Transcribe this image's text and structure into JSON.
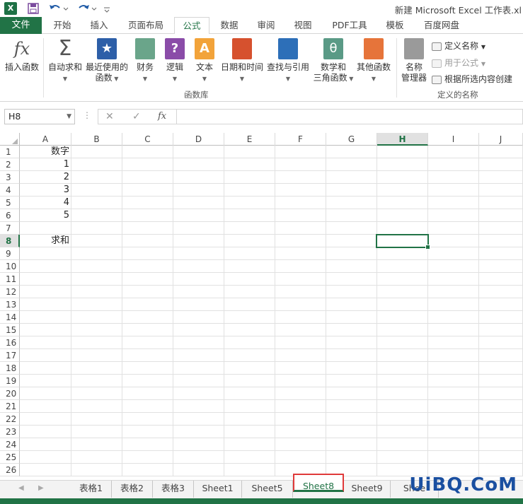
{
  "titlebar": {
    "logo": "X",
    "title": "新建 Microsoft Excel 工作表.xl"
  },
  "menu": {
    "file": "文件",
    "tabs": [
      "开始",
      "插入",
      "页面布局",
      "公式",
      "数据",
      "审阅",
      "视图",
      "PDF工具",
      "模板",
      "百度网盘"
    ],
    "active_index": 3
  },
  "ribbon": {
    "insert_function": "插入函数",
    "autosum": "自动求和",
    "recent_1": "最近使用的",
    "recent_2": "函数",
    "finance": "财务",
    "logic": "逻辑",
    "text": "文本",
    "datetime": "日期和时间",
    "lookup": "查找与引用",
    "math_1": "数学和",
    "math_2": "三角函数",
    "other": "其他函数",
    "group_functions": "函数库",
    "name_manager_1": "名称",
    "name_manager_2": "管理器",
    "define_name": "定义名称",
    "use_in_formula": "用于公式",
    "create_from_selection": "根据所选内容创建",
    "group_names": "定义的名称"
  },
  "formula_bar": {
    "name_box": "H8",
    "cancel": "✕",
    "enter": "✓",
    "fx": "fx",
    "content": ""
  },
  "sheet": {
    "columns": [
      "A",
      "B",
      "C",
      "D",
      "E",
      "F",
      "G",
      "H",
      "I",
      "J"
    ],
    "selected_column": "H",
    "selected_row": 8,
    "row_count": 26,
    "cells": {
      "A1": "数字",
      "A2": "1",
      "A3": "2",
      "A4": "3",
      "A5": "4",
      "A6": "5",
      "A8": "求和"
    }
  },
  "tabs": {
    "sheets": [
      "表格1",
      "表格2",
      "表格3",
      "Sheet1",
      "Sheet5",
      "Sheet8",
      "Sheet9",
      "Shee"
    ],
    "active": "Sheet8"
  },
  "watermark": "UiBQ.CoM",
  "colors": {
    "excel_green": "#217346",
    "highlight_red": "#e03a3a"
  }
}
